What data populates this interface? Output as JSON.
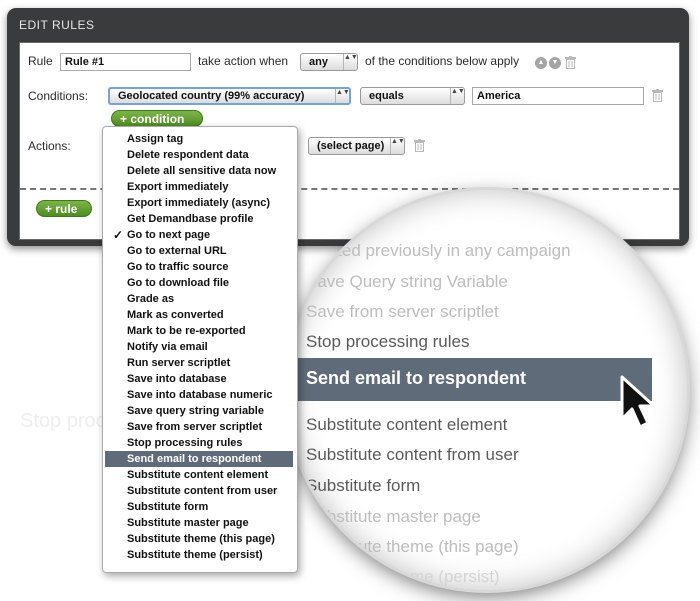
{
  "panel": {
    "title": "EDIT RULES"
  },
  "rule": {
    "label": "Rule",
    "name_value": "Rule #1",
    "take_action_text": "take action when",
    "quantifier": "any",
    "conditions_text": "of the conditions below apply"
  },
  "conditions": {
    "label": "Conditions:",
    "field": "Geolocated country (99% accuracy)",
    "operator": "equals",
    "value": "America",
    "add_label": "condition"
  },
  "actions": {
    "label": "Actions:",
    "page_select": "(select page)"
  },
  "add_rule_label": "rule",
  "background_text": {
    "line1": "Started previously in any campaign",
    "line2": "Save Query string Variable",
    "line3": "Save from server scriptlet"
  },
  "dropdown": {
    "items": [
      "Assign tag",
      "Delete respondent data",
      "Delete all sensitive data now",
      "Export immediately",
      "Export immediately (async)",
      "Get Demandbase profile",
      "Go to next page",
      "Go to external URL",
      "Go to traffic source",
      "Go to download file",
      "Grade as",
      "Mark as converted",
      "Mark to be re-exported",
      "Notify via email",
      "Run server scriptlet",
      "Save into database",
      "Save into database numeric",
      "Save query string variable",
      "Save from server scriptlet",
      "Stop processing rules",
      "Send email to respondent",
      "Substitute content element",
      "Substitute content from user",
      "Substitute form",
      "Substitute master page",
      "Substitute theme (this page)",
      "Substitute theme (persist)"
    ],
    "checked_item": "Go to next page",
    "selected_item": "Send email to respondent",
    "check_glyph": "✓"
  },
  "magnifier": {
    "items_above": [
      "Started previously in any campaign",
      "Save Query string Variable",
      "Save from server scriptlet",
      "Stop processing rules"
    ],
    "selected": "Send email to respondent",
    "items_below": [
      "Substitute content element",
      "Substitute content from user",
      "Substitute form",
      "Substitute master page",
      "Substitute theme (this page)",
      "Substitute theme (persist)"
    ]
  },
  "icons": {
    "move_up": "▲",
    "move_down": "▼",
    "select_arrows": "▲▼",
    "plus": "+"
  },
  "colors": {
    "panel_bg": "#3a3b3d",
    "selected_bg": "#5f6b78",
    "add_button_green": "#5e9a2e"
  }
}
